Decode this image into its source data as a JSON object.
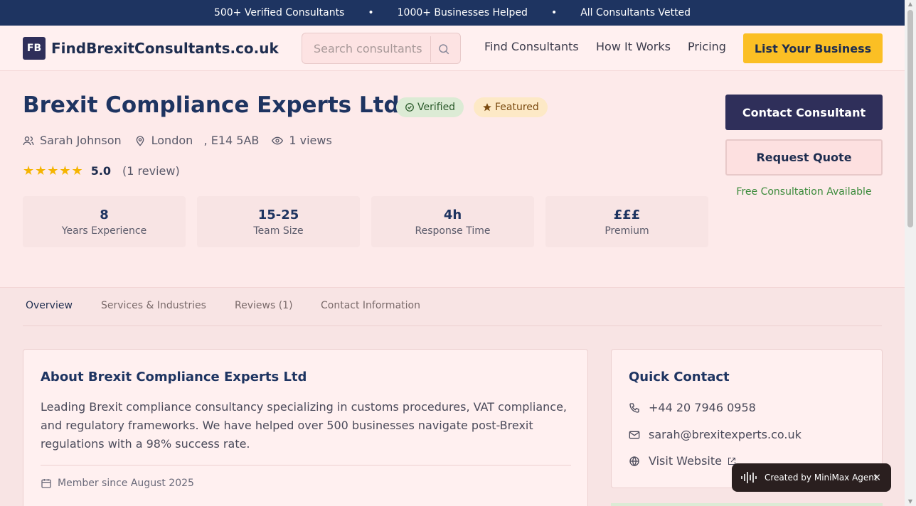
{
  "topbar": {
    "items": [
      "500+ Verified Consultants",
      "1000+ Businesses Helped",
      "All Consultants Vetted"
    ],
    "separator": "•"
  },
  "header": {
    "logo_badge": "FB",
    "logo_text": "FindBrexitConsultants.co.uk",
    "search_placeholder": "Search consultants",
    "nav": [
      "Find Consultants",
      "How It Works",
      "Pricing"
    ],
    "cta": "List Your Business"
  },
  "profile": {
    "name": "Brexit Compliance Experts Ltd",
    "badges": {
      "verified": "Verified",
      "featured": "Featured"
    },
    "contact_person": "Sarah Johnson",
    "location": "London   , E14 5AB",
    "views": "1 views",
    "stars": 5,
    "rating": "5.0",
    "reviews": "(1 review)",
    "stats": [
      {
        "value": "8",
        "label": "Years Experience"
      },
      {
        "value": "15-25",
        "label": "Team Size"
      },
      {
        "value": "4h",
        "label": "Response Time"
      },
      {
        "value": "£££",
        "label": "Premium"
      }
    ],
    "buttons": {
      "contact": "Contact Consultant",
      "quote": "Request Quote"
    },
    "free_consultation": "Free Consultation Available"
  },
  "tabs": [
    "Overview",
    "Services & Industries",
    "Reviews (1)",
    "Contact Information"
  ],
  "about": {
    "title": "About Brexit Compliance Experts Ltd",
    "body": "Leading Brexit compliance consultancy specializing in customs procedures, VAT compliance, and regulatory frameworks. We have helped over 500 businesses navigate post-Brexit regulations with a 98% success rate.",
    "member_since": "Member since August 2025"
  },
  "quick_contact": {
    "title": "Quick Contact",
    "phone": "+44 20 7946 0958",
    "email": "sarah@brexitexperts.co.uk",
    "website": "Visit Website"
  },
  "minimax": {
    "label": "Created by MiniMax Agent",
    "close": "×"
  },
  "colors": {
    "navy": "#1e3461",
    "accent": "#fbbf24",
    "green": "#3a8a3a",
    "background": "#fdeaea"
  }
}
